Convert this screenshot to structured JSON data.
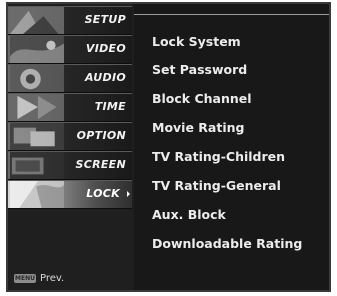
{
  "sidebar": {
    "tabs": [
      {
        "label": "SETUP",
        "icon": "setup-thumbnail-icon"
      },
      {
        "label": "VIDEO",
        "icon": "video-thumbnail-icon"
      },
      {
        "label": "AUDIO",
        "icon": "audio-thumbnail-icon"
      },
      {
        "label": "TIME",
        "icon": "time-thumbnail-icon"
      },
      {
        "label": "OPTION",
        "icon": "option-thumbnail-icon"
      },
      {
        "label": "SCREEN",
        "icon": "screen-thumbnail-icon"
      },
      {
        "label": "LOCK",
        "icon": "lock-thumbnail-icon",
        "selected": true
      }
    ]
  },
  "footer": {
    "menu_key": "MENU",
    "prev_label": "Prev."
  },
  "lock_menu": {
    "items": [
      "Lock System",
      "Set Password",
      "Block Channel",
      "Movie Rating",
      "TV Rating-Children",
      "TV Rating-General",
      "Aux. Block",
      "Downloadable Rating"
    ]
  },
  "colors": {
    "osd_background": "#1c1c1c",
    "text": "#ececec",
    "active_tab_highlight": "#d9d9d9"
  }
}
